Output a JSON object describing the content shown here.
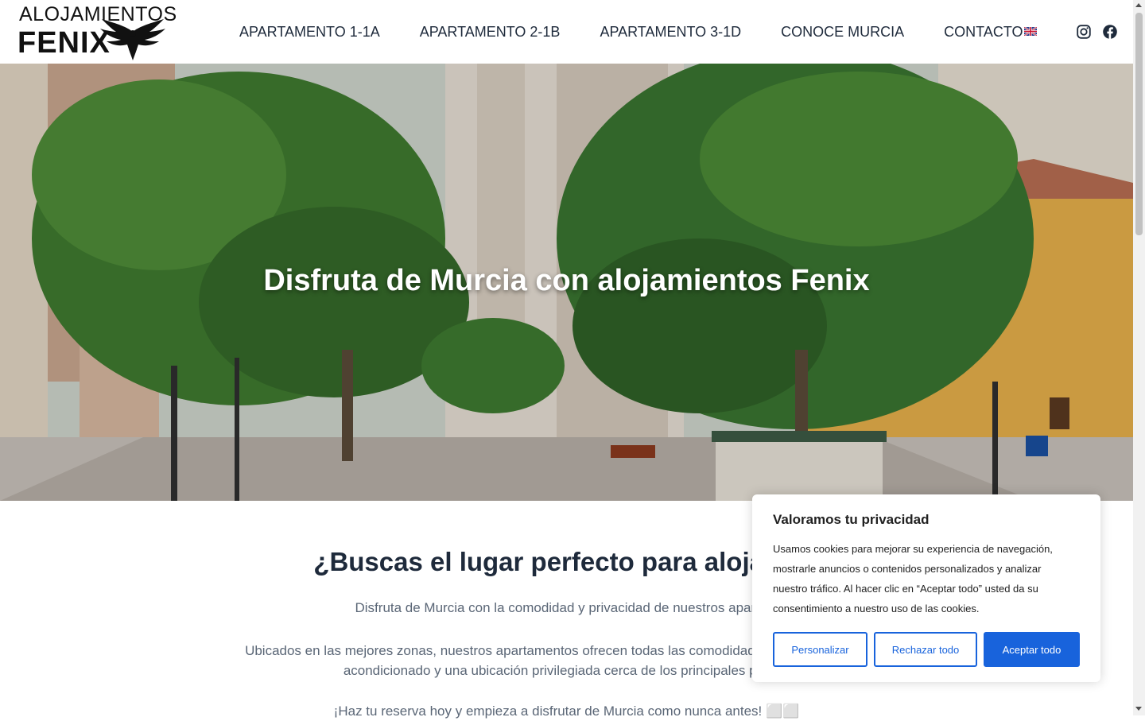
{
  "header": {
    "logo_line1": "ALOJAMIENTOS",
    "logo_line2": "FENIX",
    "nav": [
      {
        "label": "APARTAMENTO 1-1A"
      },
      {
        "label": "APARTAMENTO 2-1B"
      },
      {
        "label": "APARTAMENTO 3-1D"
      },
      {
        "label": "CONOCE MURCIA"
      },
      {
        "label": "CONTACTO"
      }
    ],
    "language_flag": "uk-flag-icon",
    "social": [
      "instagram-icon",
      "facebook-icon"
    ]
  },
  "hero": {
    "title": "Disfruta de Murcia con alojamientos Fenix"
  },
  "content": {
    "heading": "¿Buscas el lugar perfecto para alojarte e",
    "p1": "Disfruta de Murcia con la comodidad y privacidad de nuestros apartam",
    "p2_line1": "Ubicados en las mejores zonas, nuestros apartamentos ofrecen todas las comodidades que necesitas: WiF",
    "p2_line2": "acondicionado y una ubicación privilegiada cerca de los principales puntos",
    "p3": "¡Haz tu reserva hoy y empieza a disfrutar de Murcia como nunca antes! ⬜⬜"
  },
  "cookie_banner": {
    "title": "Valoramos tu privacidad",
    "text": "Usamos cookies para mejorar su experiencia de navegación, mostrarle anuncios o contenidos personalizados y analizar nuestro tráfico. Al hacer clic en “Aceptar todo” usted da su consentimiento a nuestro uso de las cookies.",
    "customize_label": "Personalizar",
    "reject_label": "Rechazar todo",
    "accept_label": "Aceptar todo"
  },
  "colors": {
    "accent": "#1863dc",
    "heading": "#1e2a3b",
    "body_text": "#5a6676"
  }
}
